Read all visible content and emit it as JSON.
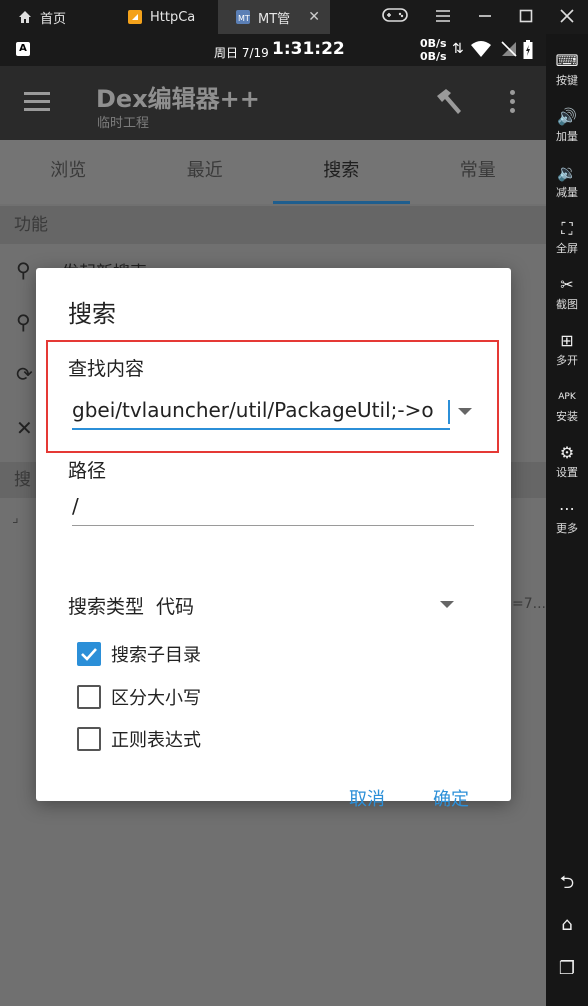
{
  "emulator": {
    "tabs": [
      {
        "label": "首页"
      },
      {
        "label": "HttpCa"
      },
      {
        "label": "MT管"
      }
    ],
    "side_controls": [
      {
        "label": "按键",
        "icon": "keyboard-icon"
      },
      {
        "label": "加量",
        "icon": "volume-up-icon"
      },
      {
        "label": "减量",
        "icon": "volume-down-icon"
      },
      {
        "label": "全屏",
        "icon": "fullscreen-icon"
      },
      {
        "label": "截图",
        "icon": "scissors-icon"
      },
      {
        "label": "多开",
        "icon": "multi-instance-icon"
      },
      {
        "label": "安装",
        "icon": "apk-icon"
      },
      {
        "label": "设置",
        "icon": "gear-icon"
      },
      {
        "label": "更多",
        "icon": "more-icon"
      }
    ]
  },
  "status_bar": {
    "day": "周日 7/19",
    "time": "1:31:22",
    "net_up": "0B/s",
    "net_down": "0B/s",
    "sim_badge": "A"
  },
  "app": {
    "title": "Dex编辑器++",
    "subtitle": "临时工程",
    "tabs": [
      "浏览",
      "最近",
      "搜索",
      "常量"
    ],
    "active_tab": "搜索",
    "section_functions": "功能",
    "background_row": "发起新搜索",
    "section_history_fragment": "搜",
    "side_fragment": "=7..."
  },
  "dialog": {
    "title": "搜索",
    "find_label": "查找内容",
    "find_value": "gbei/tvlauncher/util/PackageUtil;->o",
    "path_label": "路径",
    "path_value": "/",
    "type_label": "搜索类型",
    "type_value": "代码",
    "options": [
      {
        "label": "搜索子目录",
        "checked": true
      },
      {
        "label": "区分大小写",
        "checked": false
      },
      {
        "label": "正则表达式",
        "checked": false
      }
    ],
    "cancel_label": "取消",
    "ok_label": "确定",
    "accent_color": "#2b8fd8",
    "highlight_color": "#e53935"
  }
}
